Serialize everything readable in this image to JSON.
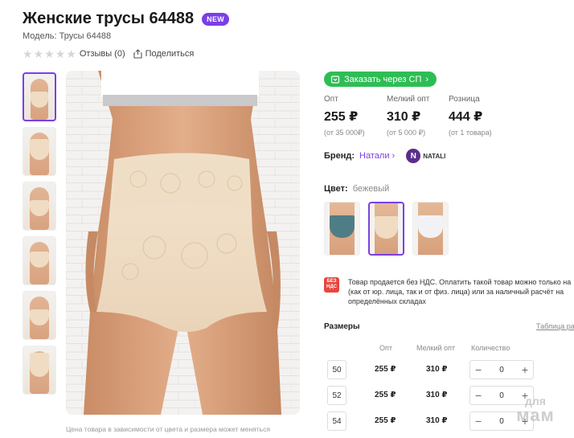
{
  "product": {
    "title": "Женские трусы 64488",
    "badge": "NEW",
    "model": "Модель: Трусы 64488",
    "reviews": "Отзывы (0)",
    "share": "Поделиться",
    "photo_caption": "Цена товара в зависимости от цвета и размера может меняться"
  },
  "order": {
    "label": "Заказать через СП"
  },
  "prices": [
    {
      "label": "Опт",
      "value": "255 ₽",
      "note": "(от 35 000₽)"
    },
    {
      "label": "Мелкий опт",
      "value": "310 ₽",
      "note": "(от 5 000 ₽)"
    },
    {
      "label": "Розница",
      "value": "444 ₽",
      "note": "(от 1 товара)"
    }
  ],
  "brand": {
    "label": "Бренд:",
    "name": "Натали",
    "logo_text": "NATALI",
    "logo_letter": "N"
  },
  "color": {
    "label": "Цвет:",
    "value": "бежевый",
    "swatches": [
      {
        "name": "teal",
        "color": "#4f7d86"
      },
      {
        "name": "beige",
        "color": "#efdcc3"
      },
      {
        "name": "white",
        "color": "#f2f2f6"
      }
    ]
  },
  "vat": {
    "icon_line1": "БЕЗ",
    "icon_line2": "НДС",
    "line1": "Товар продается без НДС. Оплатить такой товар можно только на",
    "line2": "(как от юр. лица, так и от физ. лица) или за наличный расчёт на",
    "line3": "определённых складах"
  },
  "sizes": {
    "title": "Размеры",
    "table_link": "Таблица ра",
    "headers": {
      "opt": "Опт",
      "small": "Мелкий опт",
      "qty": "Количество"
    },
    "rows": [
      {
        "size": "50",
        "opt": "255 ₽",
        "small": "310 ₽",
        "qty": "0"
      },
      {
        "size": "52",
        "opt": "255 ₽",
        "small": "310 ₽",
        "qty": "0"
      },
      {
        "size": "54",
        "opt": "255 ₽",
        "small": "310 ₽",
        "qty": "0"
      }
    ]
  },
  "watermark": {
    "line1": "для",
    "line2": "мам"
  },
  "colors": {
    "accent": "#7b3fe4",
    "order_green": "#2ebd55",
    "vat_red": "#e8453c"
  }
}
